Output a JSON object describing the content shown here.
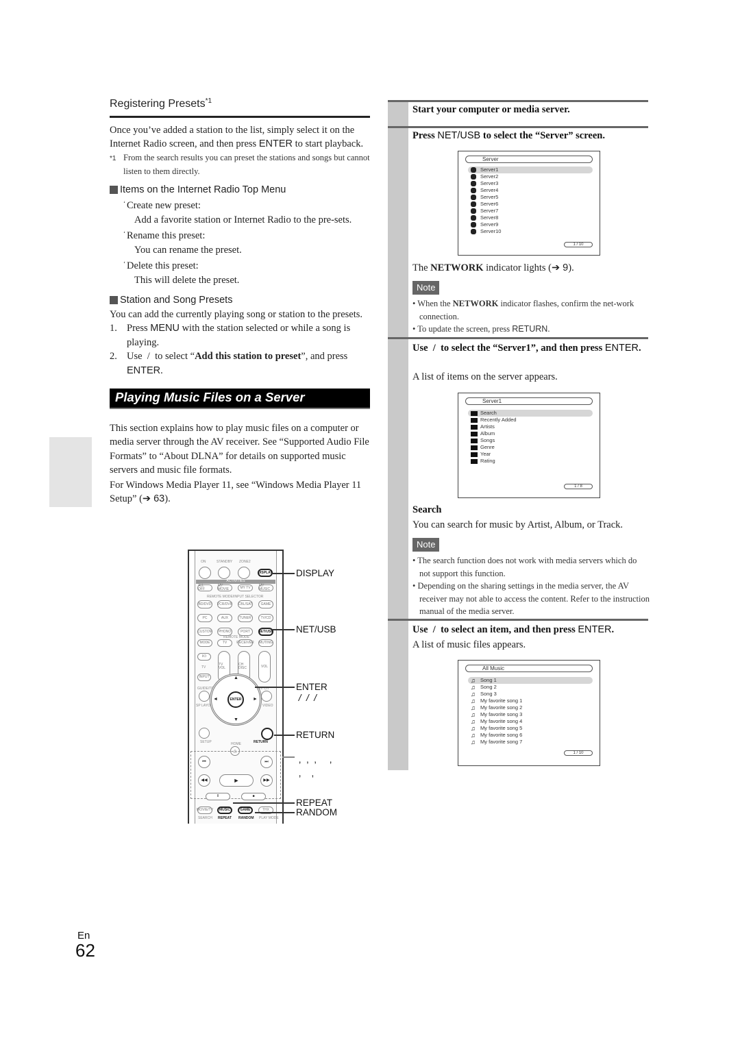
{
  "left": {
    "registering": {
      "title": "Registering Presets",
      "title_sup": "*1",
      "body_a": "Once you’ve added a station to the list, simply select it on the Internet Radio screen, and then press ",
      "body_enter": "ENTER",
      "body_b": " to start playback.",
      "footnote_mark": "*1",
      "footnote": "From the search results you can preset the stations and songs but cannot listen to them directly."
    },
    "top_menu": {
      "heading": "Items on the Internet Radio Top Menu",
      "items": [
        {
          "label": "Create new preset:",
          "desc": "Add a favorite station or Internet Radio to the pre-sets."
        },
        {
          "label": "Rename this preset:",
          "desc": "You can rename the preset."
        },
        {
          "label": "Delete this preset:",
          "desc": "This will delete the preset."
        }
      ]
    },
    "station_presets": {
      "heading": "Station and Song Presets",
      "intro": "You can add the currently playing song or station to the presets.",
      "steps": [
        {
          "num": "1.",
          "a": "Press ",
          "key": "MENU",
          "b": " with the station selected or while a song is playing."
        },
        {
          "num": "2.",
          "a": "Use  /  to select “",
          "bold": "Add this station to preset",
          "b": "”, and press ",
          "key": "ENTER",
          "c": "."
        }
      ]
    },
    "section_banner": "Playing Music Files on a Server",
    "section_intro": "This section explains how to play music files on a computer or media server through the AV receiver. See “Supported Audio File Formats” to “About DLNA” for details on supported music servers and music file formats.",
    "wmp_a": "For Windows Media Player 11, see “Windows Media Player 11 Setup” (",
    "wmp_arrow": "➔ 63",
    "wmp_b": ")."
  },
  "remote": {
    "top_labels": [
      "ON",
      "STANDBY",
      "ZONE2"
    ],
    "display_btn": "DISPLAY",
    "activities": "ACTIVITIES",
    "activity_btns": [
      "ALL OFF",
      "MY MOVIE",
      "MY TV",
      "MY MUSIC"
    ],
    "input_selector": "REMOTE MODE/INPUT SELECTOR",
    "input_rows": [
      [
        "BD/DVD",
        "VCR/DVR",
        "CBL/SAT",
        "GAME"
      ],
      [
        "PC",
        "AUX",
        "TUNER",
        "TV/CD"
      ],
      [
        "CUSTOM",
        "PHONO",
        "PORT",
        "NET/USB"
      ]
    ],
    "remote_mode": "REMOTE MODE",
    "mode_row": [
      "MODE",
      "TV",
      "RECEIVER",
      "MUTING"
    ],
    "tv_power": "I/⏻",
    "tv_label": "TV",
    "input_btn": "INPUT",
    "tv_vol": "TV VOL",
    "ch_disc": "CH DISC",
    "album": "ALBUM",
    "vol": "VOL",
    "guide": "GUIDE/TOP MENU",
    "prev": "PREV CH",
    "sp_layout": "SP LAYOUT",
    "video": "VIDEO",
    "playlist": "PLAYLIST CATEGORY",
    "enter": "ENTER",
    "setup": "SETUP",
    "home": "HOME",
    "return": "RETURN",
    "bottom_btns": [
      "MOVIE/TV",
      "MUSIC",
      "GAME",
      "THX"
    ],
    "bottom_labels": [
      "SEARCH",
      "REPEAT",
      "RANDOM",
      "PLAY MODE"
    ],
    "callouts": {
      "display": "DISPLAY",
      "netusb": "NET/USB",
      "enter": "ENTER",
      "arrows": " /  /  / ",
      "return": "RETURN",
      "transport_1": " ,  ,  ,     ,",
      "transport_2": " ,    ,",
      "repeat": "REPEAT",
      "random": "RANDOM"
    }
  },
  "right": {
    "step1": "Start your computer or media server.",
    "step2_a": "Press ",
    "step2_key": "NET/USB",
    "step2_b": " to select the “Server” screen.",
    "server_screen": {
      "title": "Server",
      "items": [
        "Server1",
        "Server2",
        "Server3",
        "Server4",
        "Server5",
        "Server6",
        "Server7",
        "Server8",
        "Server9",
        "Server10"
      ],
      "selected_index": 0,
      "page": "1 / 10"
    },
    "network_a": "The ",
    "network_bold": "NETWORK",
    "network_b": " indicator lights (",
    "network_ref": "➔ 9",
    "network_c": ").",
    "note_label": "Note",
    "note1": [
      {
        "a": "When the ",
        "bold": "NETWORK",
        "b": " indicator flashes, confirm the net-work connection."
      },
      {
        "a": "To update the screen, press ",
        "key": "RETURN",
        "b": "."
      }
    ],
    "step3_a": "Use  /  to select the “Server1”, and then press ",
    "step3_key": "ENTER",
    "step3_b": ".",
    "step3_desc": "A list of items on the server appears.",
    "server1_screen": {
      "title": "Server1",
      "items": [
        "Search",
        "Recently Added",
        "Artists",
        "Album",
        "Songs",
        "Genre",
        "Year",
        "Rating"
      ],
      "selected_index": 0,
      "page": "1 / 8"
    },
    "search_title": "Search",
    "search_desc": "You can search for music by Artist, Album, or Track.",
    "note2": [
      "The search function does not work with media servers which do not support this function.",
      "Depending on the sharing settings in the media server, the AV receiver may not able to access the content. Refer to the instruction manual of the media server."
    ],
    "step4_a": "Use  /  to select an item, and then press ",
    "step4_key": "ENTER",
    "step4_b": ".",
    "step4_desc": "A list of music files appears.",
    "music_screen": {
      "title": "All Music",
      "items": [
        "Song 1",
        "Song 2",
        "Song 3",
        "My favorite song 1",
        "My favorite song 2",
        "My favorite song 3",
        "My favorite song 4",
        "My favorite song 5",
        "My favorite song 6",
        "My favorite song 7"
      ],
      "selected_index": 0,
      "page": "1 / 10"
    }
  },
  "footer": {
    "lang": "En",
    "page_number": "62"
  }
}
